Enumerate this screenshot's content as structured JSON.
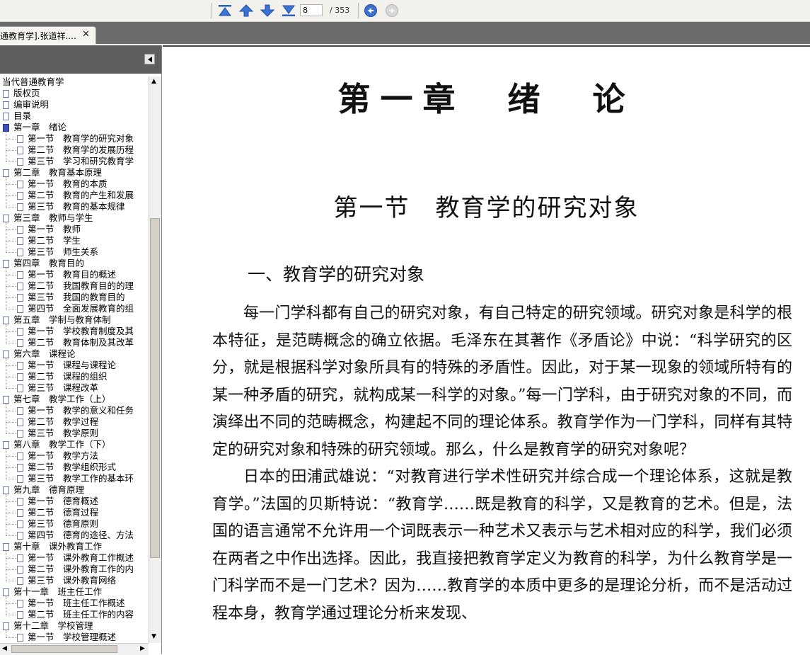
{
  "toolbar": {
    "current_page": "8",
    "total_pages": "/ 353",
    "colors": {
      "nav_blue": "#2a5fbf",
      "disabled_gray": "#c6c6c6"
    }
  },
  "tab": {
    "title": "通教育学].张道祥....",
    "close": "✕"
  },
  "sidebar": {
    "tree": [
      {
        "label": "当代普通教育学",
        "level": 0,
        "icon": false
      },
      {
        "label": "版权页",
        "level": 1
      },
      {
        "label": "编审说明",
        "level": 1
      },
      {
        "label": "目录",
        "level": 1
      },
      {
        "label": "第一章　绪论",
        "level": 1,
        "selected": true
      },
      {
        "label": "第一节　教育学的研究对象",
        "level": 2
      },
      {
        "label": "第二节　教育学的发展历程",
        "level": 2
      },
      {
        "label": "第三节　学习和研究教育学",
        "level": 2
      },
      {
        "label": "第二章　教育基本原理",
        "level": 1
      },
      {
        "label": "第一节　教育的本质",
        "level": 2
      },
      {
        "label": "第二节　教育的产生和发展",
        "level": 2
      },
      {
        "label": "第三节　教育的基本规律",
        "level": 2
      },
      {
        "label": "第三章　教师与学生",
        "level": 1
      },
      {
        "label": "第一节　教师",
        "level": 2
      },
      {
        "label": "第二节　学生",
        "level": 2
      },
      {
        "label": "第三节　师生关系",
        "level": 2
      },
      {
        "label": "第四章　教育目的",
        "level": 1
      },
      {
        "label": "第一节　教育目的概述",
        "level": 2
      },
      {
        "label": "第二节　我国教育目的的理",
        "level": 2
      },
      {
        "label": "第三节　我国的教育目的",
        "level": 2
      },
      {
        "label": "第四节　全面发展教育的组",
        "level": 2
      },
      {
        "label": "第五章　学制与教育体制",
        "level": 1
      },
      {
        "label": "第一节　学校教育制度及其",
        "level": 2
      },
      {
        "label": "第二节　教育体制及其改革",
        "level": 2
      },
      {
        "label": "第六章　课程论",
        "level": 1
      },
      {
        "label": "第一节　课程与课程论",
        "level": 2
      },
      {
        "label": "第二节　课程的组织",
        "level": 2
      },
      {
        "label": "第三节　课程改革",
        "level": 2
      },
      {
        "label": "第七章　教学工作（上）",
        "level": 1
      },
      {
        "label": "第一节　教学的意义和任务",
        "level": 2
      },
      {
        "label": "第二节　教学过程",
        "level": 2
      },
      {
        "label": "第三节　教学原则",
        "level": 2
      },
      {
        "label": "第八章　教学工作（下）",
        "level": 1
      },
      {
        "label": "第一节　教学方法",
        "level": 2
      },
      {
        "label": "第二节　教学组织形式",
        "level": 2
      },
      {
        "label": "第三节　教学工作的基本环",
        "level": 2
      },
      {
        "label": "第九章　德育原理",
        "level": 1
      },
      {
        "label": "第一节　德育概述",
        "level": 2
      },
      {
        "label": "第二节　德育过程",
        "level": 2
      },
      {
        "label": "第三节　德育原则",
        "level": 2
      },
      {
        "label": "第四节　德育的途径、方法",
        "level": 2
      },
      {
        "label": "第十章　课外教育工作",
        "level": 1
      },
      {
        "label": "第一节　课外教育工作概述",
        "level": 2
      },
      {
        "label": "第二节　课外教育工作的内",
        "level": 2
      },
      {
        "label": "第三节　课外教育网络",
        "level": 2
      },
      {
        "label": "第十一章　班主任工作",
        "level": 1
      },
      {
        "label": "第一节　班主任工作概述",
        "level": 2
      },
      {
        "label": "第二节　班主任工作的内容",
        "level": 2
      },
      {
        "label": "第十二章　学校管理",
        "level": 1
      },
      {
        "label": "第一节　学校管理概述",
        "level": 2
      }
    ]
  },
  "document": {
    "chapter_title": "第一章　绪　论",
    "section_title": "第一节　教育学的研究对象",
    "subsection_title": "一、教育学的研究对象",
    "paragraphs": [
      "每一门学科都有自己的研究对象，有自己特定的研究领域。研究对象是科学的根本特征，是范畴概念的确立依据。毛泽东在其著作《矛盾论》中说：“科学研究的区分，就是根据科学对象所具有的特殊的矛盾性。因此，对于某一现象的领域所特有的某一种矛盾的研究，就构成某一科学的对象。”每一门学科，由于研究对象的不同，而演绎出不同的范畴概念，构建起不同的理论体系。教育学作为一门学科，同样有其特定的研究对象和特殊的研究领域。那么，什么是教育学的研究对象呢？",
      "日本的田浦武雄说：“对教育进行学术性研究并综合成一个理论体系，这就是教育学。”法国的贝斯特说：“教育学……既是教育的科学，又是教育的艺术。但是，法国的语言通常不允许用一个词既表示一种艺术又表示与艺术相对应的科学，我们必须在两者之中作出选择。因此，我直接把教育学定义为教育的科学，为什么教育学是一门科学而不是一门艺术？因为……教育学的本质中更多的是理论分析，而不是活动过程本身，教育学通过理论分析来发现、"
    ]
  }
}
